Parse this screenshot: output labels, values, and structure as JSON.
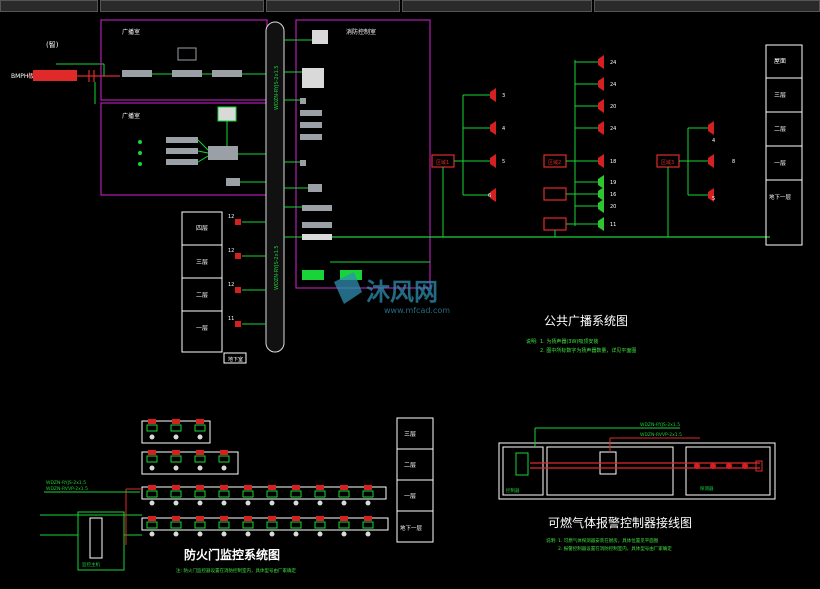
{
  "colors": {
    "background": "#000000",
    "frame": "#b01fb0",
    "wire_green": "#19d33a",
    "wire_red": "#e02a2a",
    "text_white": "#ffffff",
    "text_green": "#3fe23f",
    "device_gray": "#9aa0a6",
    "watermark": "#2f8fb0",
    "bus_fill": "#111111",
    "bus_stroke": "#dcdcdc",
    "speaker_red": "#d42020",
    "speaker_green": "#31c431"
  },
  "app": {
    "tabs": [
      "",
      "",
      "",
      "",
      ""
    ]
  },
  "broadcast_diagram": {
    "title": "公共广播系统图",
    "source_label": "(智)",
    "input_label": "BMPH板",
    "rooms": {
      "room1_label": "广播室",
      "room2_label": "广播室",
      "control_label": "消防控制室"
    },
    "floors_right": [
      "屋面",
      "三层",
      "二层",
      "一层",
      "地下一层"
    ],
    "floors_left": [
      "四层",
      "三层",
      "二层",
      "一层"
    ],
    "left_box_label": "地下室",
    "zone_labels": [
      "区域1",
      "区域2",
      "区域3"
    ],
    "speaker_numbers_left": [
      "3",
      "4",
      "5",
      "6"
    ],
    "speaker_numbers_mid": [
      "24",
      "24",
      "20",
      "24",
      "18",
      "19",
      "16",
      "20",
      "11"
    ],
    "speaker_numbers_right": [
      "4",
      "8",
      "5"
    ],
    "floor_numbers_left": [
      "12",
      "12",
      "12",
      "11"
    ],
    "cable_note": "WDZN-RYJS-2x1.5",
    "notes_heading": "说明:",
    "notes": [
      "1. 为扬声器(3W)吸顶安装",
      "2. 图中所标数字为扬声器数量，详见平面图"
    ]
  },
  "firedoor_diagram": {
    "title": "防火门监控系统图",
    "floors": [
      "三层",
      "二层",
      "一层",
      "地下一层"
    ],
    "host_label": "监控主机",
    "cable_note1": "WDZN-RYJS-2x1.5",
    "cable_note2": "WDZN-RVVP-2x1.5",
    "note": "注: 防火门监控器设置在消防控制室内，具体型号由厂家确定"
  },
  "gas_diagram": {
    "title": "可燃气体报警控制器接线图",
    "controller_label": "控制器",
    "detector_label": "探测器",
    "cable_note1": "WDZN-RYJS-2x1.5",
    "cable_note2": "WDZN-RVVP-2x1.5",
    "notes_heading": "说明:",
    "notes": [
      "1. 可燃气体探测器安装在厨房，具体位置见平面图",
      "2. 报警控制器设置在消防控制室内，具体型号由厂家确定"
    ]
  },
  "watermark": {
    "logo_text": "沐风网",
    "url": "www.mfcad.com"
  }
}
